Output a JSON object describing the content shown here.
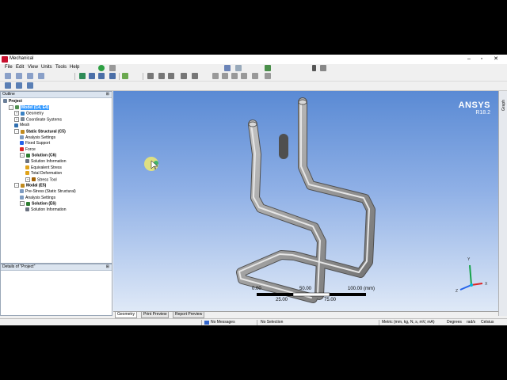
{
  "window": {
    "title": "Mechanical"
  },
  "menu": [
    "File",
    "Edit",
    "View",
    "Units",
    "Tools",
    "Help"
  ],
  "outline": {
    "header": "Outline",
    "tree": [
      {
        "label": "Project",
        "level": 0,
        "bold": true,
        "expander": "",
        "icon": "project-icon"
      },
      {
        "label": "Model (C4, E4)",
        "level": 1,
        "bold": true,
        "selected": true,
        "expander": "-",
        "icon": "model-icon"
      },
      {
        "label": "Geometry",
        "level": 2,
        "expander": "+",
        "icon": "geometry-icon"
      },
      {
        "label": "Coordinate Systems",
        "level": 2,
        "expander": "+",
        "icon": "coordinate-icon"
      },
      {
        "label": "Mesh",
        "level": 2,
        "expander": "",
        "icon": "mesh-icon"
      },
      {
        "label": "Static Structural (C5)",
        "level": 2,
        "bold": true,
        "expander": "-",
        "icon": "static-icon"
      },
      {
        "label": "Analysis Settings",
        "level": 3,
        "expander": "",
        "icon": "settings-icon"
      },
      {
        "label": "Fixed Support",
        "level": 3,
        "expander": "",
        "icon": "support-icon"
      },
      {
        "label": "Force",
        "level": 3,
        "expander": "",
        "icon": "force-icon"
      },
      {
        "label": "Solution (C6)",
        "level": 3,
        "bold": true,
        "expander": "-",
        "icon": "solution-icon"
      },
      {
        "label": "Solution Information",
        "level": 4,
        "expander": "",
        "icon": "info-icon"
      },
      {
        "label": "Equivalent Stress",
        "level": 4,
        "expander": "",
        "icon": "result-icon"
      },
      {
        "label": "Total Deformation",
        "level": 4,
        "expander": "",
        "icon": "result-icon"
      },
      {
        "label": "Stress Tool",
        "level": 4,
        "expander": "+",
        "icon": "tool-icon"
      },
      {
        "label": "Modal (E5)",
        "level": 2,
        "bold": true,
        "expander": "-",
        "icon": "modal-icon"
      },
      {
        "label": "Pre-Stress (Static Structural)",
        "level": 3,
        "expander": "",
        "icon": "prestress-icon"
      },
      {
        "label": "Analysis Settings",
        "level": 3,
        "expander": "",
        "icon": "settings-icon"
      },
      {
        "label": "Solution (E6)",
        "level": 3,
        "bold": true,
        "expander": "-",
        "icon": "solution-icon"
      },
      {
        "label": "Solution Information",
        "level": 4,
        "expander": "",
        "icon": "info-icon"
      }
    ]
  },
  "details": {
    "header": "Details of \"Project\""
  },
  "viewport": {
    "logo": "ANSYS",
    "version": "R18.2",
    "scale": {
      "top_labels": [
        "0.00",
        "50.00",
        "100.00 (mm)"
      ],
      "bottom_labels": [
        "25.00",
        "75.00"
      ]
    }
  },
  "graph_tab": "Graph",
  "view_tabs": [
    "Geometry",
    "Print Preview",
    "Report Preview"
  ],
  "status": {
    "messages": "No Messages",
    "selection": "No Selection",
    "units": "Metric (mm, kg, N, s, mV, mA)",
    "angle": "Degrees",
    "rate": "rad/s",
    "temp": "Celsius"
  },
  "colors": {
    "selection": "#3399ff",
    "viewport_top": "#5a8ad4",
    "viewport_bottom": "#dfe9f7",
    "logo": "#ffffff"
  }
}
